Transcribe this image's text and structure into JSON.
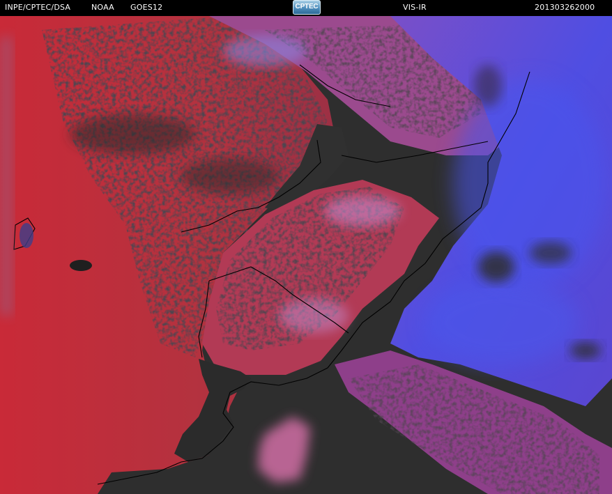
{
  "header": {
    "agency": "INPE/CPTEC/DSA",
    "operator": "NOAA",
    "satellite": "GOES12",
    "logo_text": "CPTEC",
    "band": "VIS-IR",
    "timestamp": "201303262000"
  },
  "colors": {
    "header_bg": "#000000",
    "header_text": "#ffffff",
    "clear_surface": "#2d2d2d",
    "land_warm": "#c8303c",
    "low_cloud": "#b04a7a",
    "high_cloud": "#4d4ae0",
    "coastline": "#000000"
  }
}
